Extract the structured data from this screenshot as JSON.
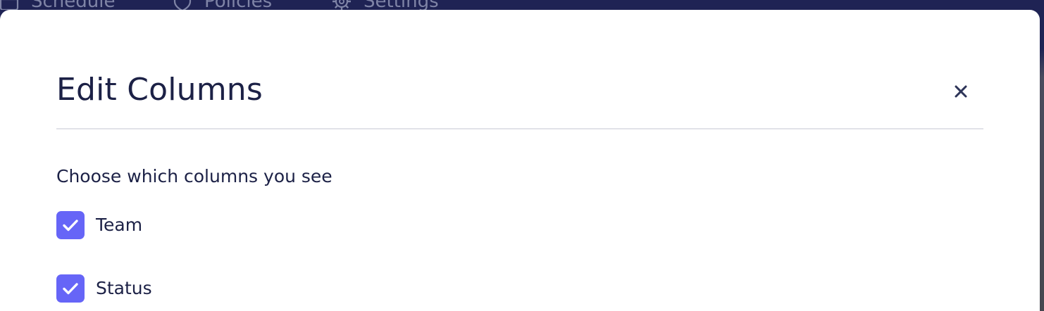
{
  "nav": {
    "items": [
      {
        "label": "Schedule",
        "icon": "calendar-icon"
      },
      {
        "label": "Policies",
        "icon": "shield-icon"
      },
      {
        "label": "Settings",
        "icon": "gear-icon"
      }
    ]
  },
  "modal": {
    "title": "Edit Columns",
    "close_icon": "close-icon",
    "subtitle": "Choose which columns you see",
    "options": [
      {
        "label": "Team",
        "checked": true
      },
      {
        "label": "Status",
        "checked": true
      }
    ]
  },
  "colors": {
    "nav_background": "#1f2354",
    "text_primary": "#1c2146",
    "checkbox_accent": "#6665f7",
    "divider": "#e1e2e8"
  }
}
